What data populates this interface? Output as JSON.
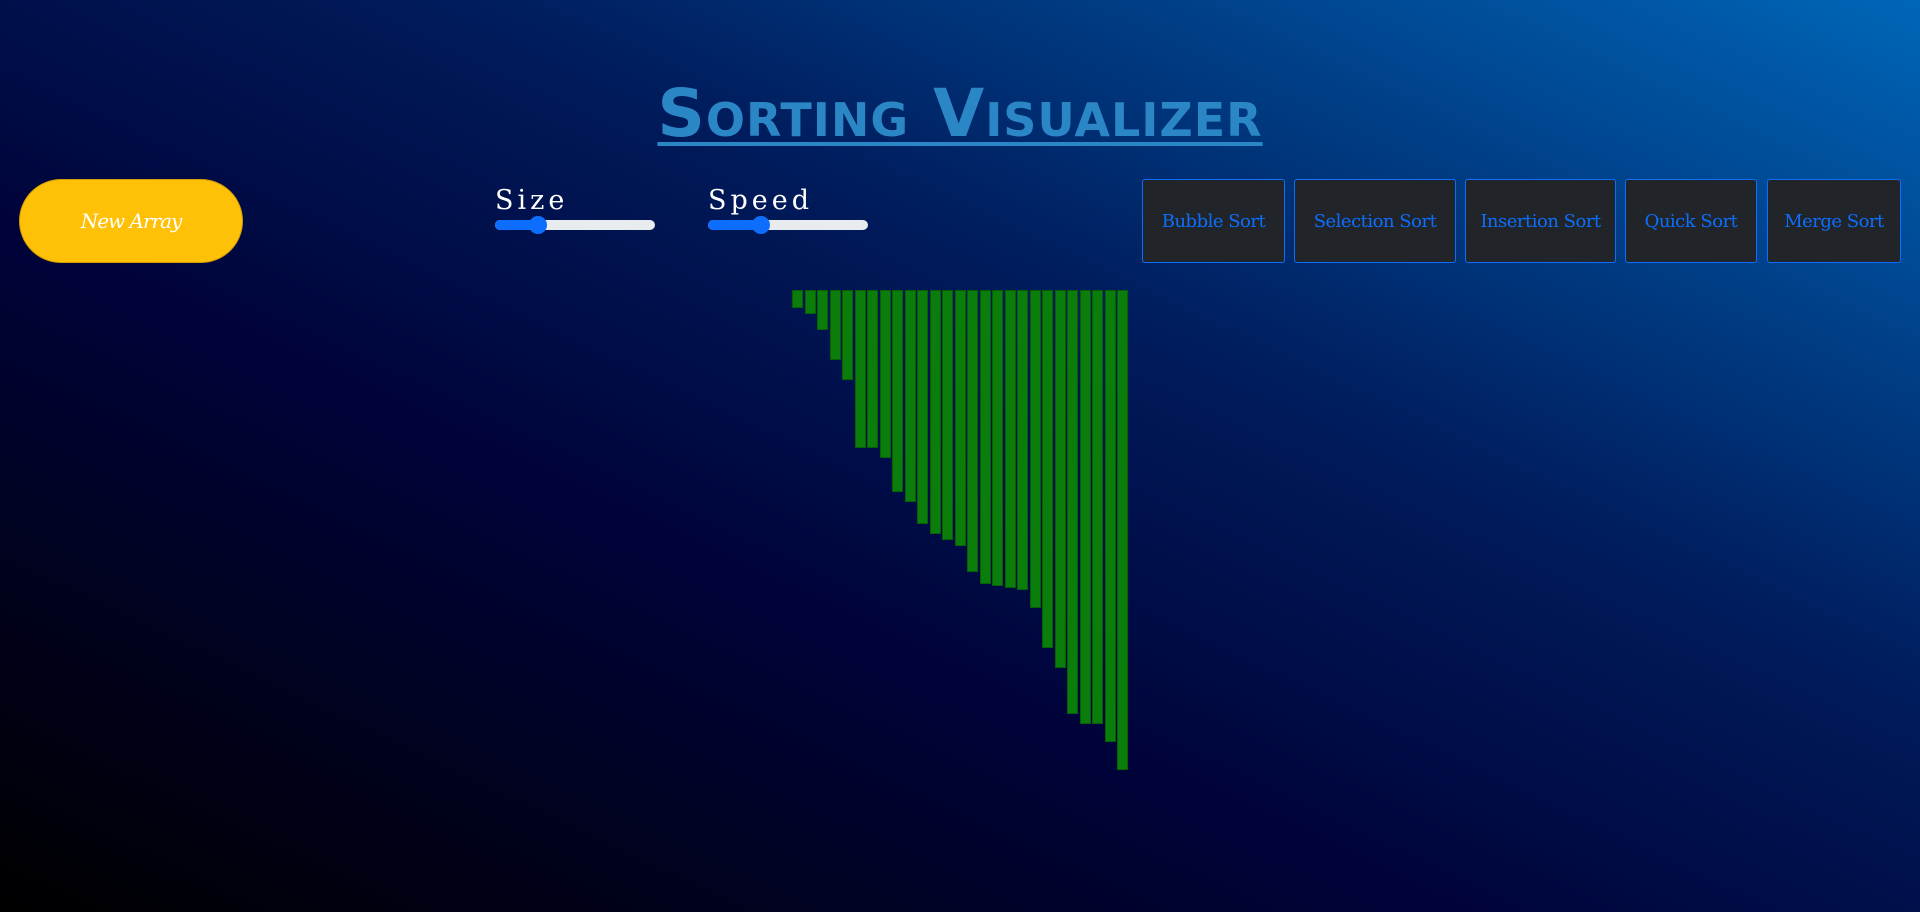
{
  "header": {
    "title": "Sorting Visualizer"
  },
  "controls": {
    "new_array_label": "New Array",
    "size": {
      "label": "Size",
      "value_fraction": 0.27
    },
    "speed": {
      "label": "Speed",
      "value_fraction": 0.33
    }
  },
  "algorithms": [
    {
      "label": "Bubble Sort"
    },
    {
      "label": "Selection Sort"
    },
    {
      "label": "Insertion Sort"
    },
    {
      "label": "Quick Sort"
    },
    {
      "label": "Merge Sort"
    }
  ],
  "colors": {
    "bar": "#0a7d0a",
    "new_array_button": "#ffc107",
    "accent": "#0d6efd",
    "title": "#2b86c5"
  },
  "array": {
    "values": [
      18,
      24,
      40,
      70,
      90,
      158,
      158,
      168,
      202,
      212,
      234,
      244,
      250,
      256,
      282,
      294,
      296,
      298,
      300,
      318,
      358,
      378,
      424,
      434,
      434,
      452,
      480
    ]
  }
}
